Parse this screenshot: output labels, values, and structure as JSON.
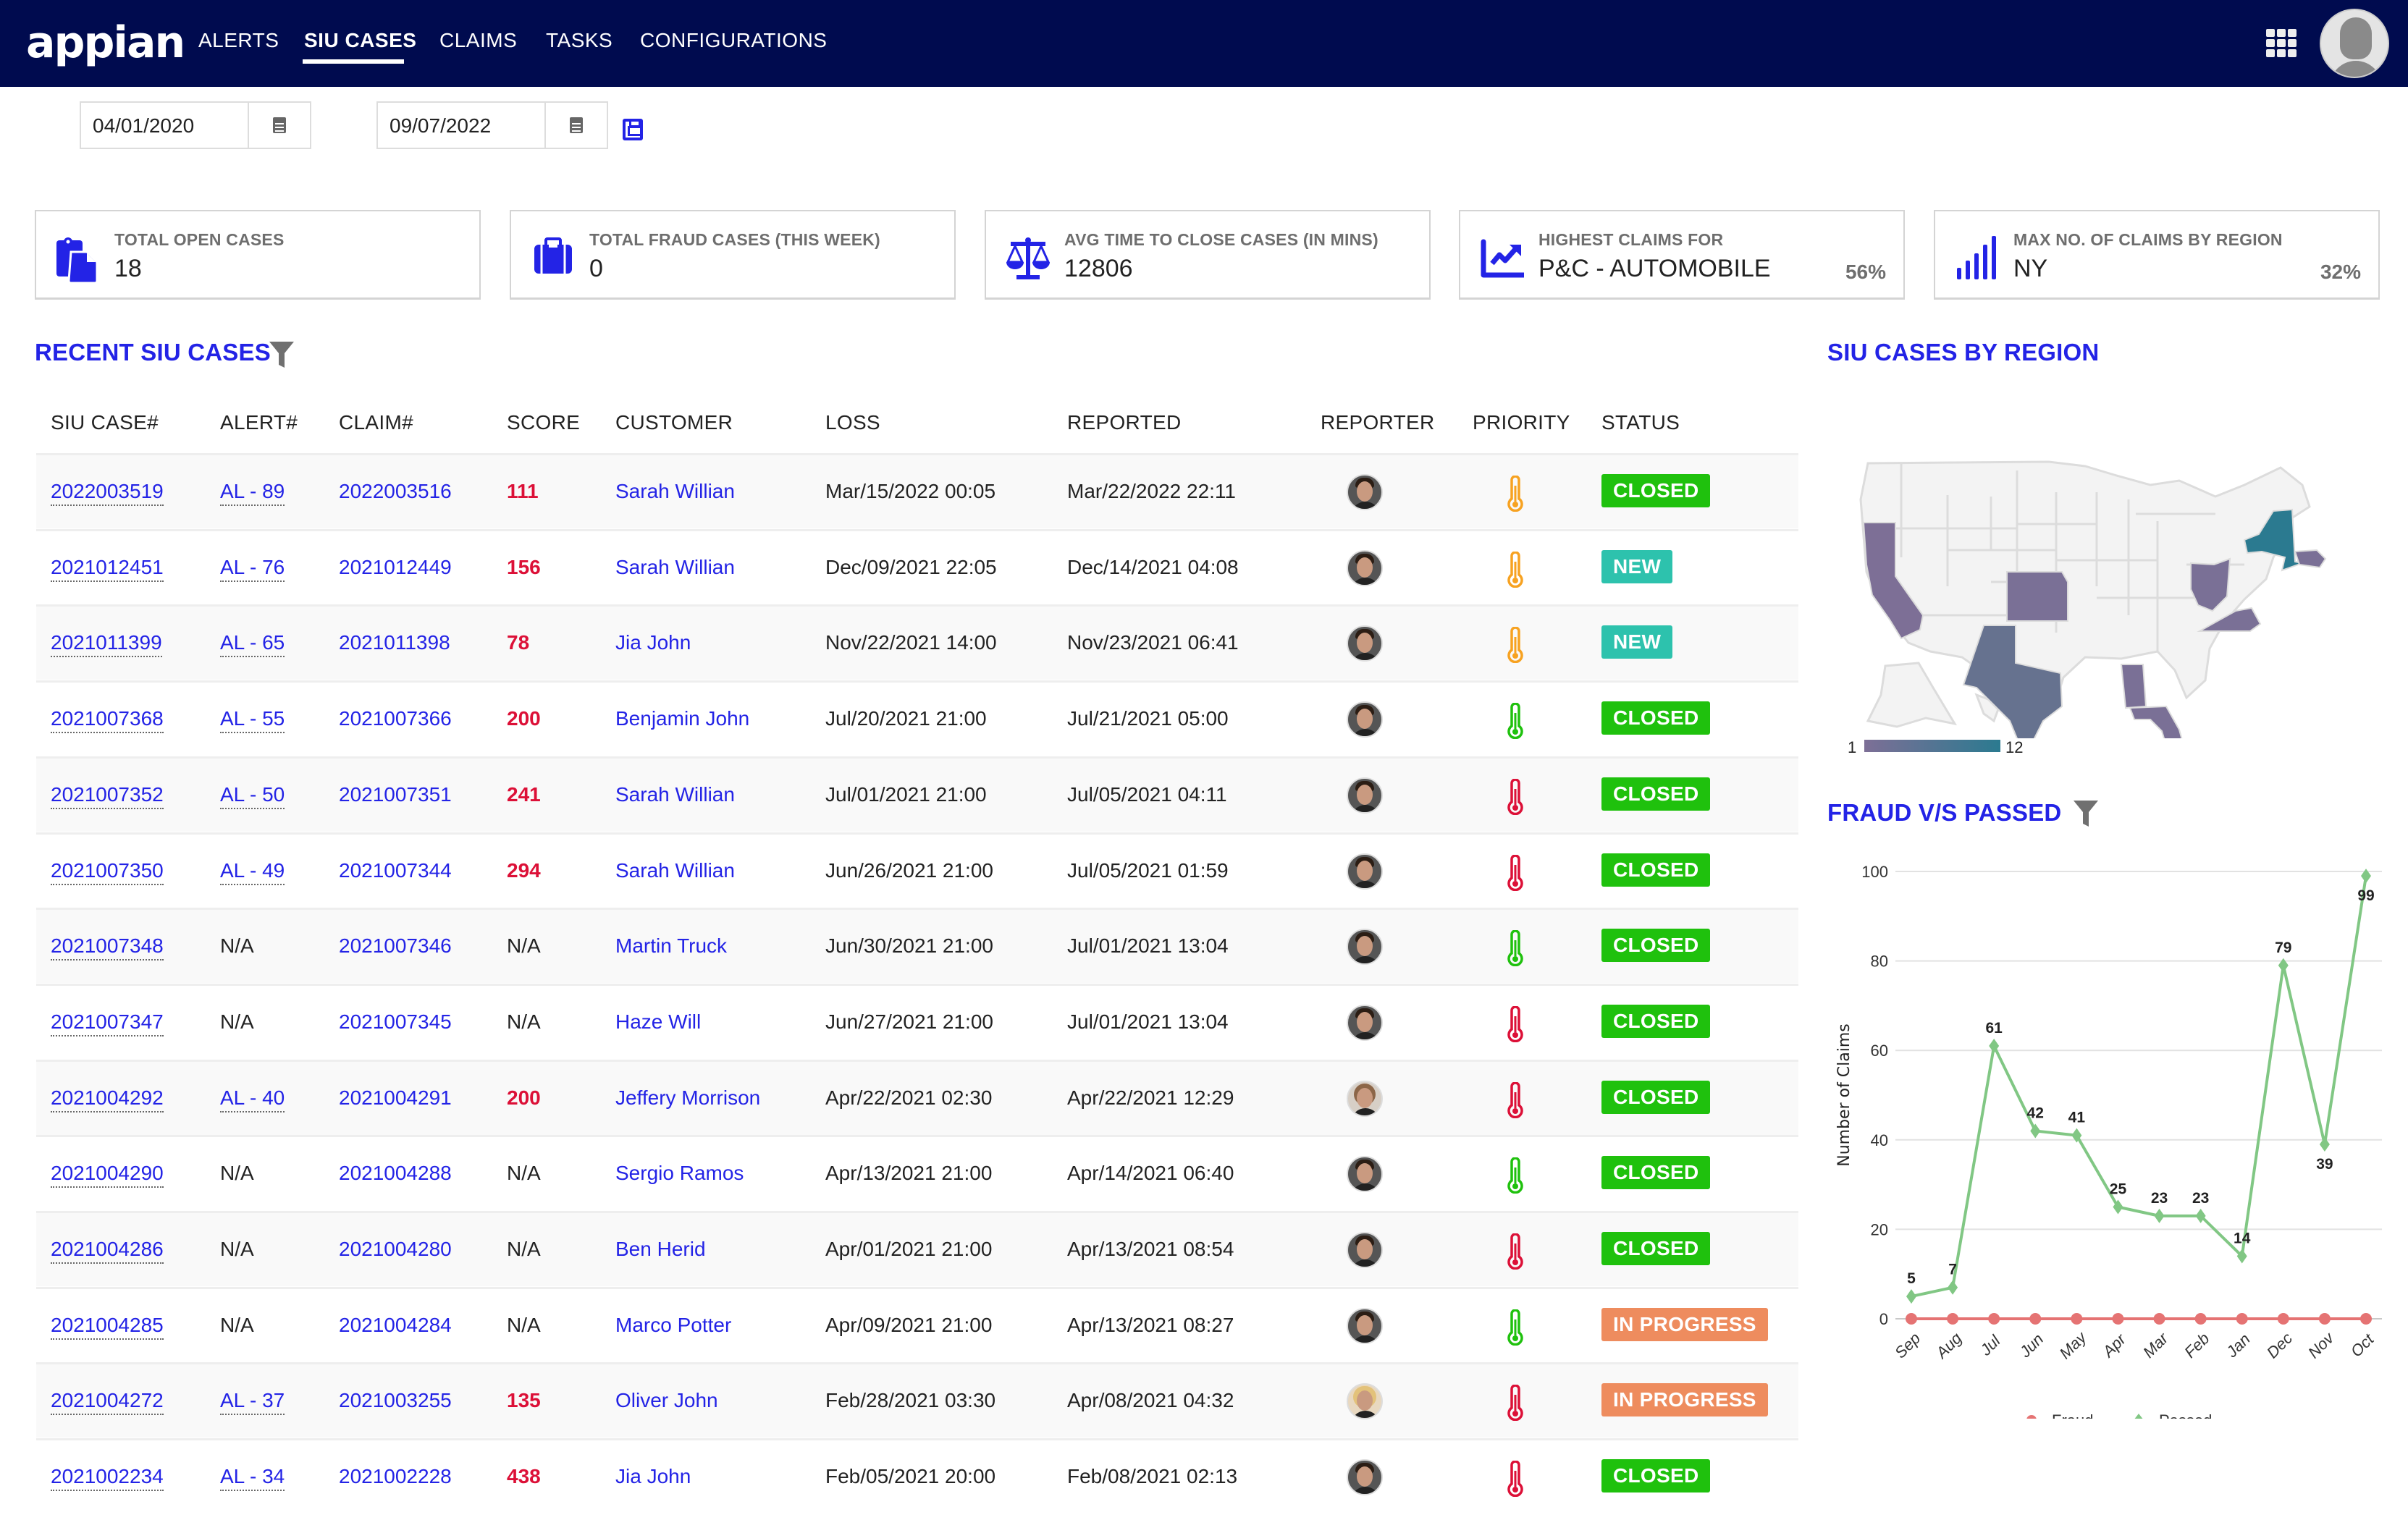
{
  "app": {
    "logo": "appian",
    "nav": [
      {
        "label": "ALERTS",
        "active": false
      },
      {
        "label": "SIU CASES",
        "active": true
      },
      {
        "label": "CLAIMS",
        "active": false
      },
      {
        "label": "TASKS",
        "active": false
      },
      {
        "label": "CONFIGURATIONS",
        "active": false
      }
    ],
    "icons": {
      "apps": "grid-icon",
      "user": "user-avatar-icon"
    }
  },
  "filters": {
    "start_date": "04/01/2020",
    "end_date": "09/07/2022",
    "calendar_icon": "calendar-icon",
    "save_icon": "floppy-disk-icon"
  },
  "kpis": [
    {
      "label": "TOTAL OPEN CASES",
      "value": "18",
      "pct": "",
      "icon": "clipboard-copy-icon"
    },
    {
      "label": "TOTAL FRAUD CASES (THIS WEEK)",
      "value": "0",
      "pct": "",
      "icon": "briefcase-icon"
    },
    {
      "label": "AVG TIME TO CLOSE CASES (IN MINS)",
      "value": "12806",
      "pct": "",
      "icon": "balance-scale-icon"
    },
    {
      "label": "HIGHEST CLAIMS FOR",
      "value": "P&C - AUTOMOBILE",
      "pct": "56%",
      "icon": "trend-chart-icon"
    },
    {
      "label": "MAX NO. OF CLAIMS BY REGION",
      "value": "NY",
      "pct": "32%",
      "icon": "signal-bars-icon"
    }
  ],
  "colors": {
    "nav_bg": "#000b4f",
    "accent": "#2323e6",
    "score": "#dc1037",
    "status_closed": "#1fc10d",
    "status_new": "#2dc2ad",
    "status_in_progress": "#ee8c5e",
    "priority_high": "#dc1037",
    "priority_medium": "#f7a221",
    "priority_low": "#1fc10d"
  },
  "cases": {
    "title": "RECENT SIU CASES",
    "columns": [
      "SIU CASE#",
      "ALERT#",
      "CLAIM#",
      "SCORE",
      "CUSTOMER",
      "LOSS",
      "REPORTED",
      "REPORTER",
      "PRIORITY",
      "STATUS"
    ],
    "rows": [
      {
        "case": "2022003519",
        "alert": "AL - 89",
        "claim": "2022003516",
        "score": "111",
        "customer": "Sarah Willian",
        "loss": "Mar/15/2022 00:05",
        "reported": "Mar/22/2022 22:11",
        "reporter": "male",
        "priority": "medium",
        "status": "CLOSED"
      },
      {
        "case": "2021012451",
        "alert": "AL - 76",
        "claim": "2021012449",
        "score": "156",
        "customer": "Sarah Willian",
        "loss": "Dec/09/2021 22:05",
        "reported": "Dec/14/2021 04:08",
        "reporter": "male",
        "priority": "medium",
        "status": "NEW"
      },
      {
        "case": "2021011399",
        "alert": "AL - 65",
        "claim": "2021011398",
        "score": "78",
        "customer": "Jia John",
        "loss": "Nov/22/2021 14:00",
        "reported": "Nov/23/2021 06:41",
        "reporter": "male",
        "priority": "medium",
        "status": "NEW"
      },
      {
        "case": "2021007368",
        "alert": "AL - 55",
        "claim": "2021007366",
        "score": "200",
        "customer": "Benjamin John",
        "loss": "Jul/20/2021 21:00",
        "reported": "Jul/21/2021 05:00",
        "reporter": "male",
        "priority": "low",
        "status": "CLOSED"
      },
      {
        "case": "2021007352",
        "alert": "AL - 50",
        "claim": "2021007351",
        "score": "241",
        "customer": "Sarah Willian",
        "loss": "Jul/01/2021 21:00",
        "reported": "Jul/05/2021 04:11",
        "reporter": "male",
        "priority": "high",
        "status": "CLOSED"
      },
      {
        "case": "2021007350",
        "alert": "AL - 49",
        "claim": "2021007344",
        "score": "294",
        "customer": "Sarah Willian",
        "loss": "Jun/26/2021 21:00",
        "reported": "Jul/05/2021 01:59",
        "reporter": "male",
        "priority": "high",
        "status": "CLOSED"
      },
      {
        "case": "2021007348",
        "alert": "N/A",
        "claim": "2021007346",
        "score": "N/A",
        "customer": "Martin Truck",
        "loss": "Jun/30/2021 21:00",
        "reported": "Jul/01/2021 13:04",
        "reporter": "male",
        "priority": "low",
        "status": "CLOSED"
      },
      {
        "case": "2021007347",
        "alert": "N/A",
        "claim": "2021007345",
        "score": "N/A",
        "customer": "Haze Will",
        "loss": "Jun/27/2021 21:00",
        "reported": "Jul/01/2021 13:04",
        "reporter": "male",
        "priority": "high",
        "status": "CLOSED"
      },
      {
        "case": "2021004292",
        "alert": "AL - 40",
        "claim": "2021004291",
        "score": "200",
        "customer": "Jeffery Morrison",
        "loss": "Apr/22/2021 02:30",
        "reported": "Apr/22/2021 12:29",
        "reporter": "female",
        "priority": "high",
        "status": "CLOSED"
      },
      {
        "case": "2021004290",
        "alert": "N/A",
        "claim": "2021004288",
        "score": "N/A",
        "customer": "Sergio Ramos",
        "loss": "Apr/13/2021 21:00",
        "reported": "Apr/14/2021 06:40",
        "reporter": "male",
        "priority": "low",
        "status": "CLOSED"
      },
      {
        "case": "2021004286",
        "alert": "N/A",
        "claim": "2021004280",
        "score": "N/A",
        "customer": "Ben Herid",
        "loss": "Apr/01/2021 21:00",
        "reported": "Apr/13/2021 08:54",
        "reporter": "male",
        "priority": "high",
        "status": "CLOSED"
      },
      {
        "case": "2021004285",
        "alert": "N/A",
        "claim": "2021004284",
        "score": "N/A",
        "customer": "Marco Potter",
        "loss": "Apr/09/2021 21:00",
        "reported": "Apr/13/2021 08:27",
        "reporter": "male",
        "priority": "low",
        "status": "IN PROGRESS"
      },
      {
        "case": "2021004272",
        "alert": "AL - 37",
        "claim": "2021003255",
        "score": "135",
        "customer": "Oliver John",
        "loss": "Feb/28/2021 03:30",
        "reported": "Apr/08/2021 04:32",
        "reporter": "female2",
        "priority": "high",
        "status": "IN PROGRESS"
      },
      {
        "case": "2021002234",
        "alert": "AL - 34",
        "claim": "2021002228",
        "score": "438",
        "customer": "Jia John",
        "loss": "Feb/05/2021 20:00",
        "reported": "Feb/08/2021 02:13",
        "reporter": "male",
        "priority": "high",
        "status": "CLOSED"
      }
    ]
  },
  "region_map": {
    "title": "SIU CASES BY REGION",
    "legend_min": "1",
    "legend_max": "12",
    "highlighted_states": [
      "CA",
      "KS",
      "TX",
      "AL",
      "FL",
      "OH",
      "VA",
      "NY",
      "MA"
    ]
  },
  "chart_data": {
    "type": "line",
    "title": "FRAUD V/S PASSED",
    "xlabel": "",
    "ylabel": "Number of Claims",
    "categories": [
      "Sep",
      "Aug",
      "Jul",
      "Jun",
      "May",
      "Apr",
      "Mar",
      "Feb",
      "Jan",
      "Dec",
      "Nov",
      "Oct"
    ],
    "ylim": [
      0,
      100
    ],
    "yticks": [
      0,
      20,
      40,
      60,
      80,
      100
    ],
    "grid": true,
    "legend": "bottom",
    "series": [
      {
        "name": "Fraud",
        "color": "#e57373",
        "marker": "circle",
        "values": [
          0,
          0,
          0,
          0,
          0,
          0,
          0,
          0,
          0,
          0,
          0,
          0
        ],
        "show_labels": false
      },
      {
        "name": "Passed",
        "color": "#81c784",
        "marker": "diamond",
        "values": [
          5,
          7,
          61,
          42,
          41,
          25,
          23,
          23,
          14,
          79,
          39,
          99
        ],
        "show_labels": true
      }
    ]
  }
}
